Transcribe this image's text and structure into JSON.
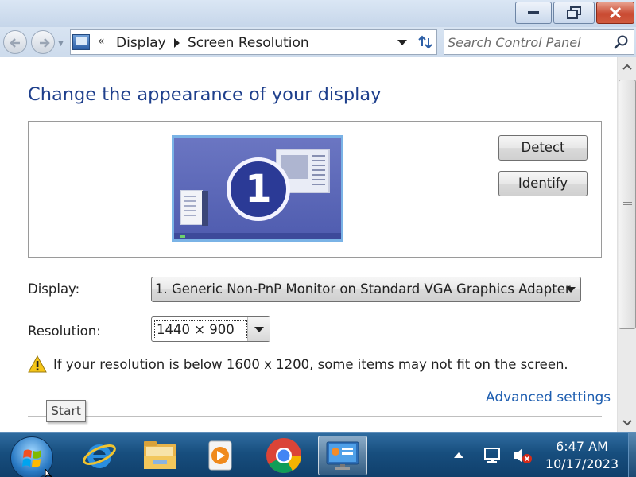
{
  "window": {
    "minimize_label": "Minimize",
    "maximize_label": "Restore",
    "close_label": "Close"
  },
  "address": {
    "overflow": "«",
    "crumbs": [
      "Display",
      "Screen Resolution"
    ]
  },
  "search": {
    "placeholder": "Search Control Panel"
  },
  "page": {
    "heading": "Change the appearance of your display",
    "monitor_number": "1",
    "detect_button": "Detect",
    "identify_button": "Identify",
    "display_label": "Display:",
    "display_value": "1. Generic Non-PnP Monitor on Standard VGA Graphics Adapter",
    "resolution_label": "Resolution:",
    "resolution_value": "1440 × 900",
    "warning_text": "If your resolution is below 1600 x 1200, some items may not fit on the screen.",
    "advanced_link": "Advanced settings"
  },
  "tooltip": {
    "text": "Start"
  },
  "taskbar": {
    "items": [
      "internet-explorer",
      "windows-explorer",
      "media-player",
      "chrome",
      "display-settings"
    ],
    "clock_time": "6:47 AM",
    "clock_date": "10/17/2023"
  },
  "colors": {
    "heading": "#1e3f8c",
    "link": "#1e5eb0",
    "taskbar": "#174e7e",
    "close_button": "#c94a32"
  }
}
